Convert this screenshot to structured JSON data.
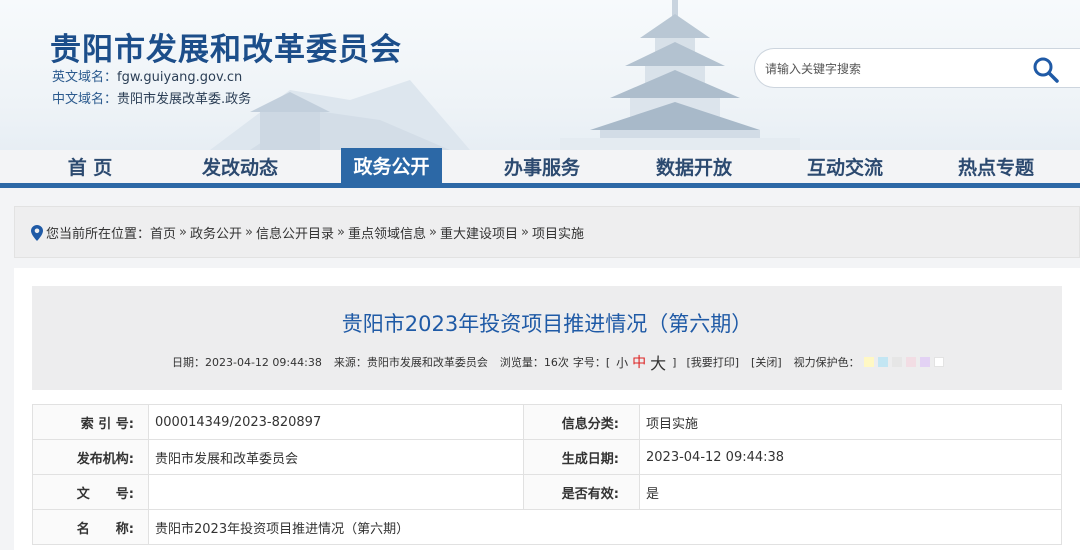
{
  "site": {
    "title": "贵阳市发展和改革委员会",
    "en_domain_label": "英文域名：",
    "en_domain": "fgw.guiyang.gov.cn",
    "cn_domain_label": "中文域名：",
    "cn_domain": "贵阳市发展改革委.政务"
  },
  "search": {
    "placeholder": "请输入关键字搜索",
    "icon": "search-icon"
  },
  "nav": {
    "items": [
      "首 页",
      "发改动态",
      "政务公开",
      "办事服务",
      "数据开放",
      "互动交流",
      "热点专题"
    ],
    "active_index": 2,
    "accent": "#2c68a6"
  },
  "breadcrumb": {
    "prefix": "您当前所在位置：",
    "items": [
      "首页",
      "政务公开",
      "信息公开目录",
      "重点领域信息",
      "重大建设项目",
      "项目实施"
    ],
    "separator": "»"
  },
  "article": {
    "title": "贵阳市2023年投资项目推进情况（第六期）",
    "date_label": "日期：",
    "date": "2023-04-12 09:44:38",
    "source_label": "来源：",
    "source": "贵阳市发展和改革委员会",
    "views_label": "浏览量：",
    "views": "16次",
    "fontsize_label": "字号：",
    "bracket_open": "[",
    "bracket_close": "]",
    "font_small": "小",
    "font_mid": "中",
    "font_big": "大",
    "print": "[我要打印]",
    "close": "[关闭]",
    "eye_label": "视力保护色：",
    "eye_colors": [
      "#fff8c4",
      "#c3e6f3",
      "#e6e6e6",
      "#f2dde4",
      "#e3d2f4",
      "#ffffff"
    ]
  },
  "info_table": {
    "index_label": "索 引 号:",
    "index_value": "000014349/2023-820897",
    "category_label": "信息分类:",
    "category_value": "项目实施",
    "publisher_label": "发布机构:",
    "publisher_value": "贵阳市发展和改革委员会",
    "created_label": "生成日期:",
    "created_value": "2023-04-12 09:44:38",
    "docno_label": "文　　号:",
    "docno_value": "",
    "valid_label": "是否有效:",
    "valid_value": "是",
    "name_label": "名　　称:",
    "name_value": "贵阳市2023年投资项目推进情况（第六期）"
  }
}
